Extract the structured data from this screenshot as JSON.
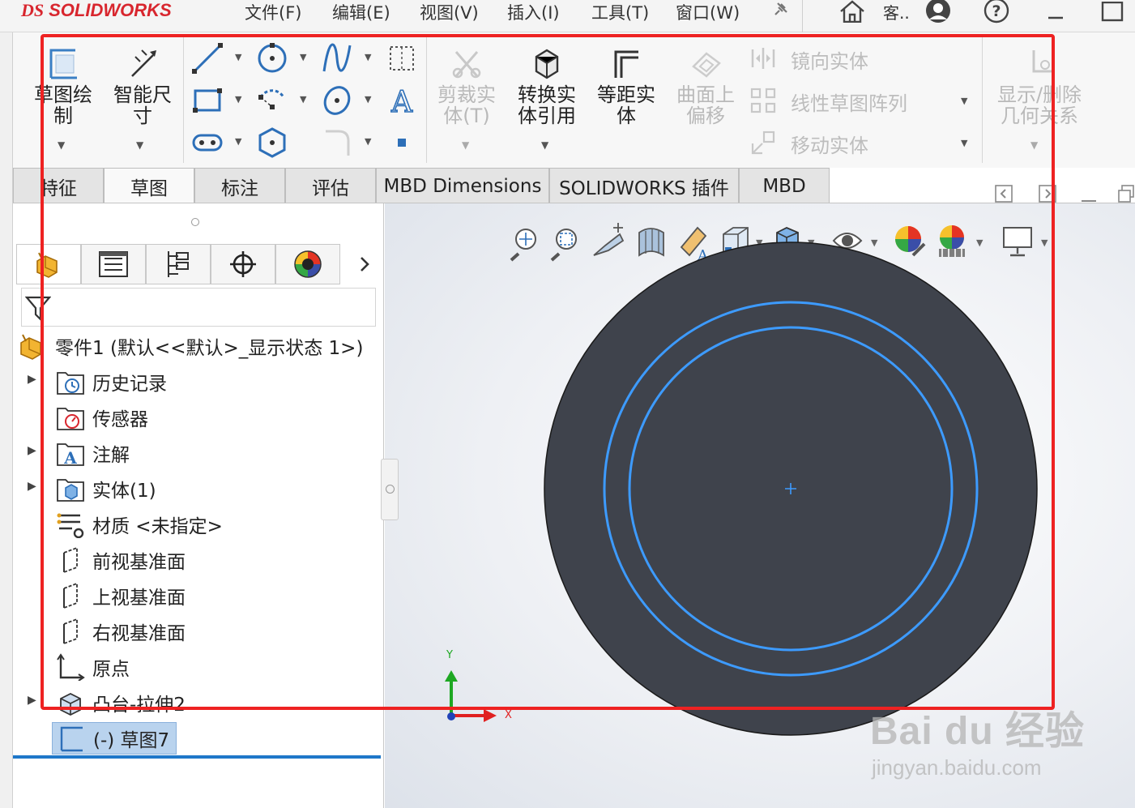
{
  "app": {
    "logo_prefix": "DS",
    "logo_name": "SOLIDWORKS"
  },
  "menu": [
    "文件(F)",
    "编辑(E)",
    "视图(V)",
    "插入(I)",
    "工具(T)",
    "窗口(W)"
  ],
  "title_user": "客..",
  "ribbon": {
    "sketch": "草图绘\n制",
    "smart_dim": "智能尺\n寸",
    "trim": "剪裁实\n体(T)",
    "convert": "转换实\n体引用",
    "offset": "等距实\n体",
    "surface_offset": "曲面上\n偏移",
    "mirror": "镜向实体",
    "linear_pattern": "线性草图阵列",
    "move": "移动实体",
    "show_delete": "显示/删除\n几何关系"
  },
  "tabs": [
    {
      "label": "特征",
      "active": false
    },
    {
      "label": "草图",
      "active": true
    },
    {
      "label": "标注",
      "active": false
    },
    {
      "label": "评估",
      "active": false
    },
    {
      "label": "MBD Dimensions",
      "active": false
    },
    {
      "label": "SOLIDWORKS 插件",
      "active": false
    },
    {
      "label": "MBD",
      "active": false
    }
  ],
  "tree": {
    "root": "零件1  (默认<<默认>_显示状态 1>)",
    "items": [
      {
        "label": "历史记录",
        "icon": "history-icon",
        "expandable": true
      },
      {
        "label": "传感器",
        "icon": "sensor-icon",
        "expandable": false
      },
      {
        "label": "注解",
        "icon": "annotation-icon",
        "expandable": true
      },
      {
        "label": "实体(1)",
        "icon": "solid-body-icon",
        "expandable": true
      },
      {
        "label": "材质 <未指定>",
        "icon": "material-icon",
        "expandable": false
      },
      {
        "label": "前视基准面",
        "icon": "plane-icon",
        "expandable": false
      },
      {
        "label": "上视基准面",
        "icon": "plane-icon",
        "expandable": false
      },
      {
        "label": "右视基准面",
        "icon": "plane-icon",
        "expandable": false
      },
      {
        "label": "原点",
        "icon": "origin-icon",
        "expandable": false
      },
      {
        "label": "凸台-拉伸2",
        "icon": "extrude-icon",
        "expandable": true
      }
    ],
    "active_sketch": "(-) 草图7"
  },
  "axes": {
    "x": "X",
    "y": "Y"
  },
  "watermark": {
    "main": "Bai du 经验",
    "sub": "jingyan.baidu.com"
  },
  "colors": {
    "accent": "#1e77c9",
    "part_body": "#3f434c",
    "sketch_line": "#3d9bff",
    "highlight": "#ee2222"
  }
}
